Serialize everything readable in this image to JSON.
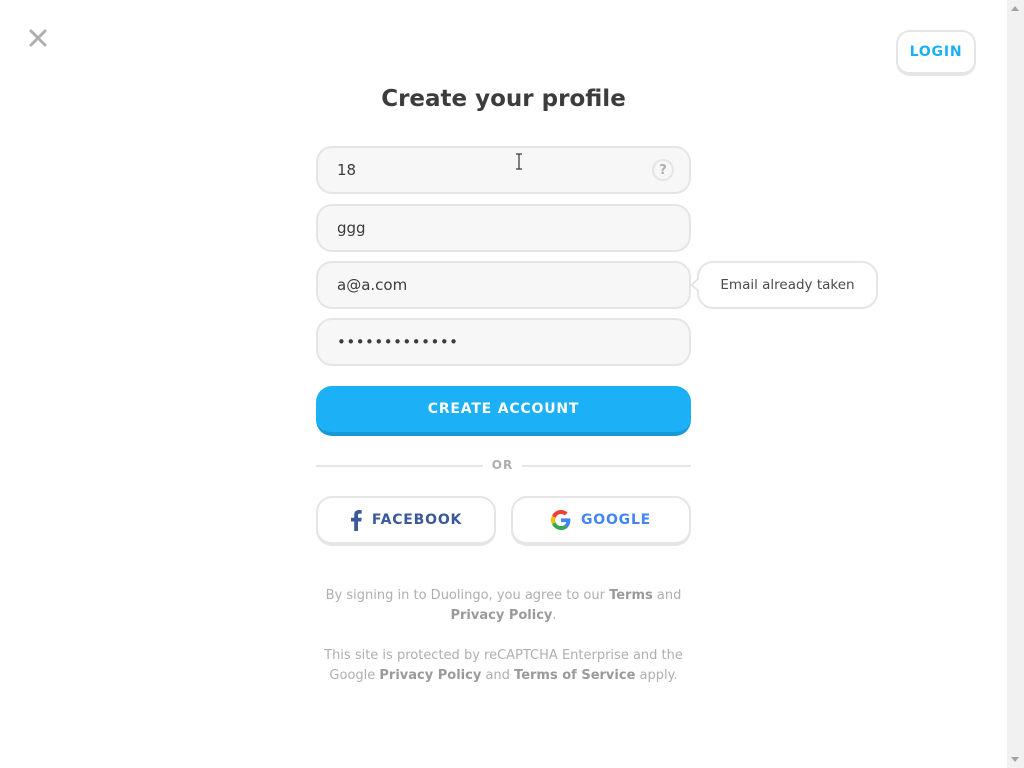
{
  "header": {
    "login_label": "LOGIN"
  },
  "title": "Create your profile",
  "form": {
    "age_value": "18",
    "help_icon_glyph": "?",
    "name_value": "ggg",
    "email_value": "a@a.com",
    "password_value": "•••••••••••••",
    "email_error": "Email already taken",
    "create_label": "CREATE ACCOUNT"
  },
  "divider": {
    "label": "OR"
  },
  "social": {
    "facebook_label": "FACEBOOK",
    "google_label": "GOOGLE"
  },
  "legal": {
    "line1_pre": "By signing in to Duolingo, you agree to our ",
    "terms": "Terms",
    "and1": " and ",
    "privacy": "Privacy Policy",
    "period": ".",
    "line2_pre": "This site is protected by reCAPTCHA Enterprise and the Google ",
    "google_privacy": "Privacy Policy",
    "and2": " and ",
    "google_terms": "Terms of Service",
    "apply": " apply."
  },
  "colors": {
    "accent": "#1cb0f6",
    "accent_dark": "#1899d6",
    "facebook": "#3b5998",
    "google": "#4285f4",
    "border": "#e5e5e5",
    "field_bg": "#f7f7f7",
    "muted_text": "#afafaf"
  },
  "icons": {
    "close": "close-icon",
    "help": "question-icon",
    "facebook": "facebook-icon",
    "google": "google-icon"
  }
}
